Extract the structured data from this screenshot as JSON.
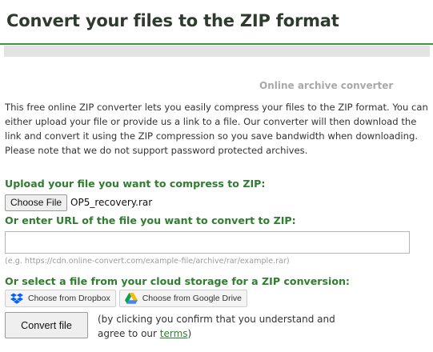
{
  "header": {
    "title": "Convert your files to the ZIP format"
  },
  "subtitle": "Online archive converter",
  "description": "This free online ZIP converter lets you easily compress your files to the ZIP format. You can either upload your file or provide us a link to a file. Our converter will then download the link and convert it using the ZIP compression so you save bandwidth when downloading. Please note that we do not support password protected archives.",
  "upload": {
    "label": "Upload your file you want to compress to ZIP:",
    "choose_button": "Choose File",
    "file_name": "OP5_recovery.rar"
  },
  "url": {
    "label": "Or enter URL of the file you want to convert to ZIP:",
    "value": "",
    "example": "(e.g. https://cdn.online-convert.com/example-file/archive/rar/example.rar)"
  },
  "cloud": {
    "label": "Or select a file from your cloud storage for a ZIP conversion:",
    "dropbox_button": "Choose from Dropbox",
    "dropbox_icon": "dropbox-icon",
    "gdrive_button": "Choose from Google Drive",
    "gdrive_icon": "google-drive-icon"
  },
  "convert": {
    "button": "Convert file",
    "consent_text": "(by clicking you confirm that you understand and agree to our ",
    "terms_link": "terms",
    "consent_end": ")"
  },
  "colors": {
    "accent_green": "#2f7d2f",
    "header_rule": "#3a9a3a",
    "dropbox_blue": "#0061fe"
  }
}
